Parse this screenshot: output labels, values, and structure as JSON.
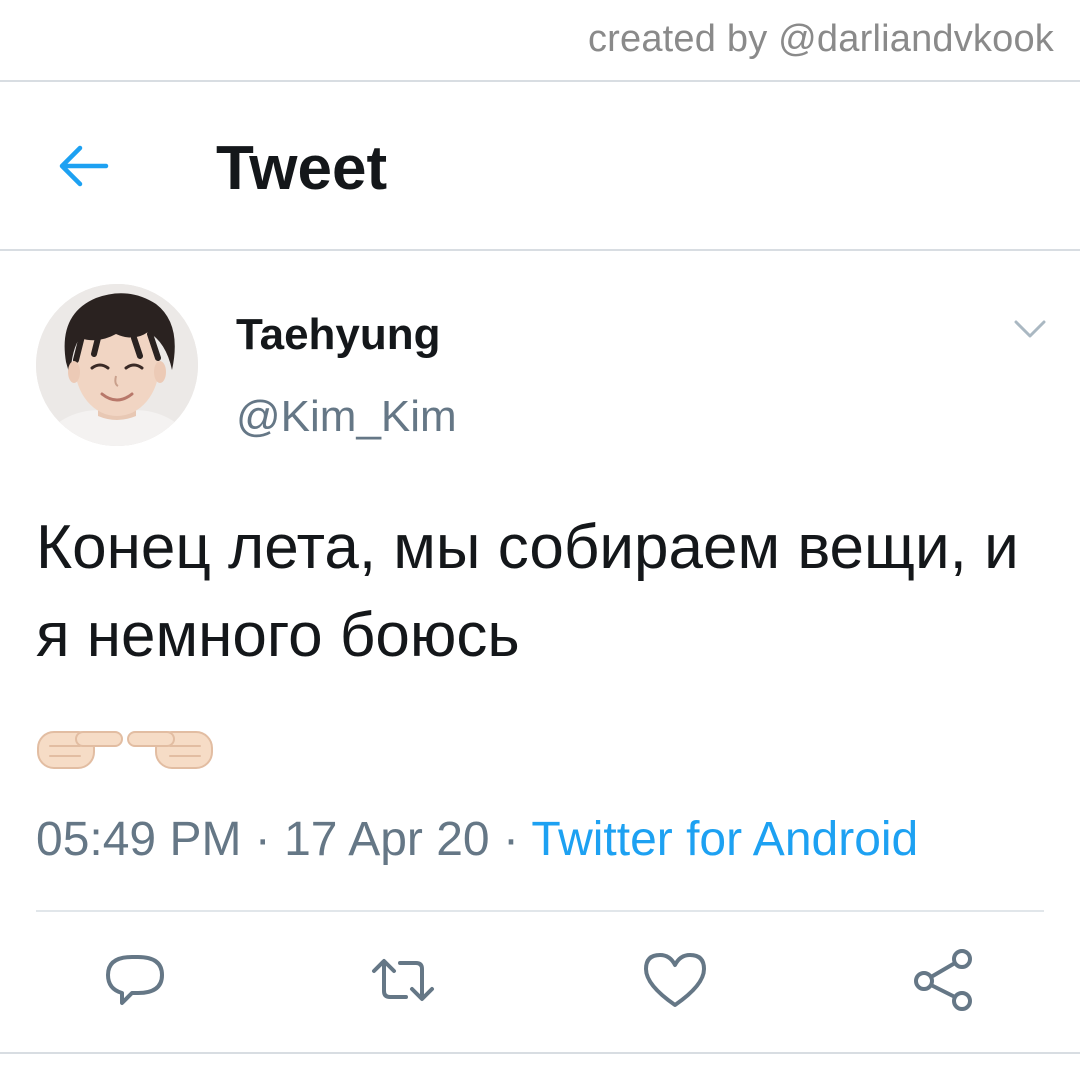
{
  "watermark": "created by @darliandvkook",
  "header": {
    "title": "Tweet",
    "back_icon": "arrow-left-icon"
  },
  "tweet": {
    "author": {
      "display_name": "Taehyung",
      "handle": "@Kim_Kim"
    },
    "text": "Конец лета, мы собираем вещи, и я немного боюсь",
    "emoji": "👉👈",
    "meta": {
      "time": "05:49 PM",
      "separator1": " · ",
      "date": "17 Apr 20",
      "separator2": " · ",
      "source": "Twitter for Android"
    }
  },
  "actions": {
    "reply_icon": "reply-icon",
    "retweet_icon": "retweet-icon",
    "like_icon": "heart-icon",
    "share_icon": "share-icon"
  },
  "colors": {
    "accent": "#1da1f2",
    "text": "#14171a",
    "secondary": "#657786",
    "divider": "#d8dde2",
    "watermark": "#8a8a8a"
  }
}
